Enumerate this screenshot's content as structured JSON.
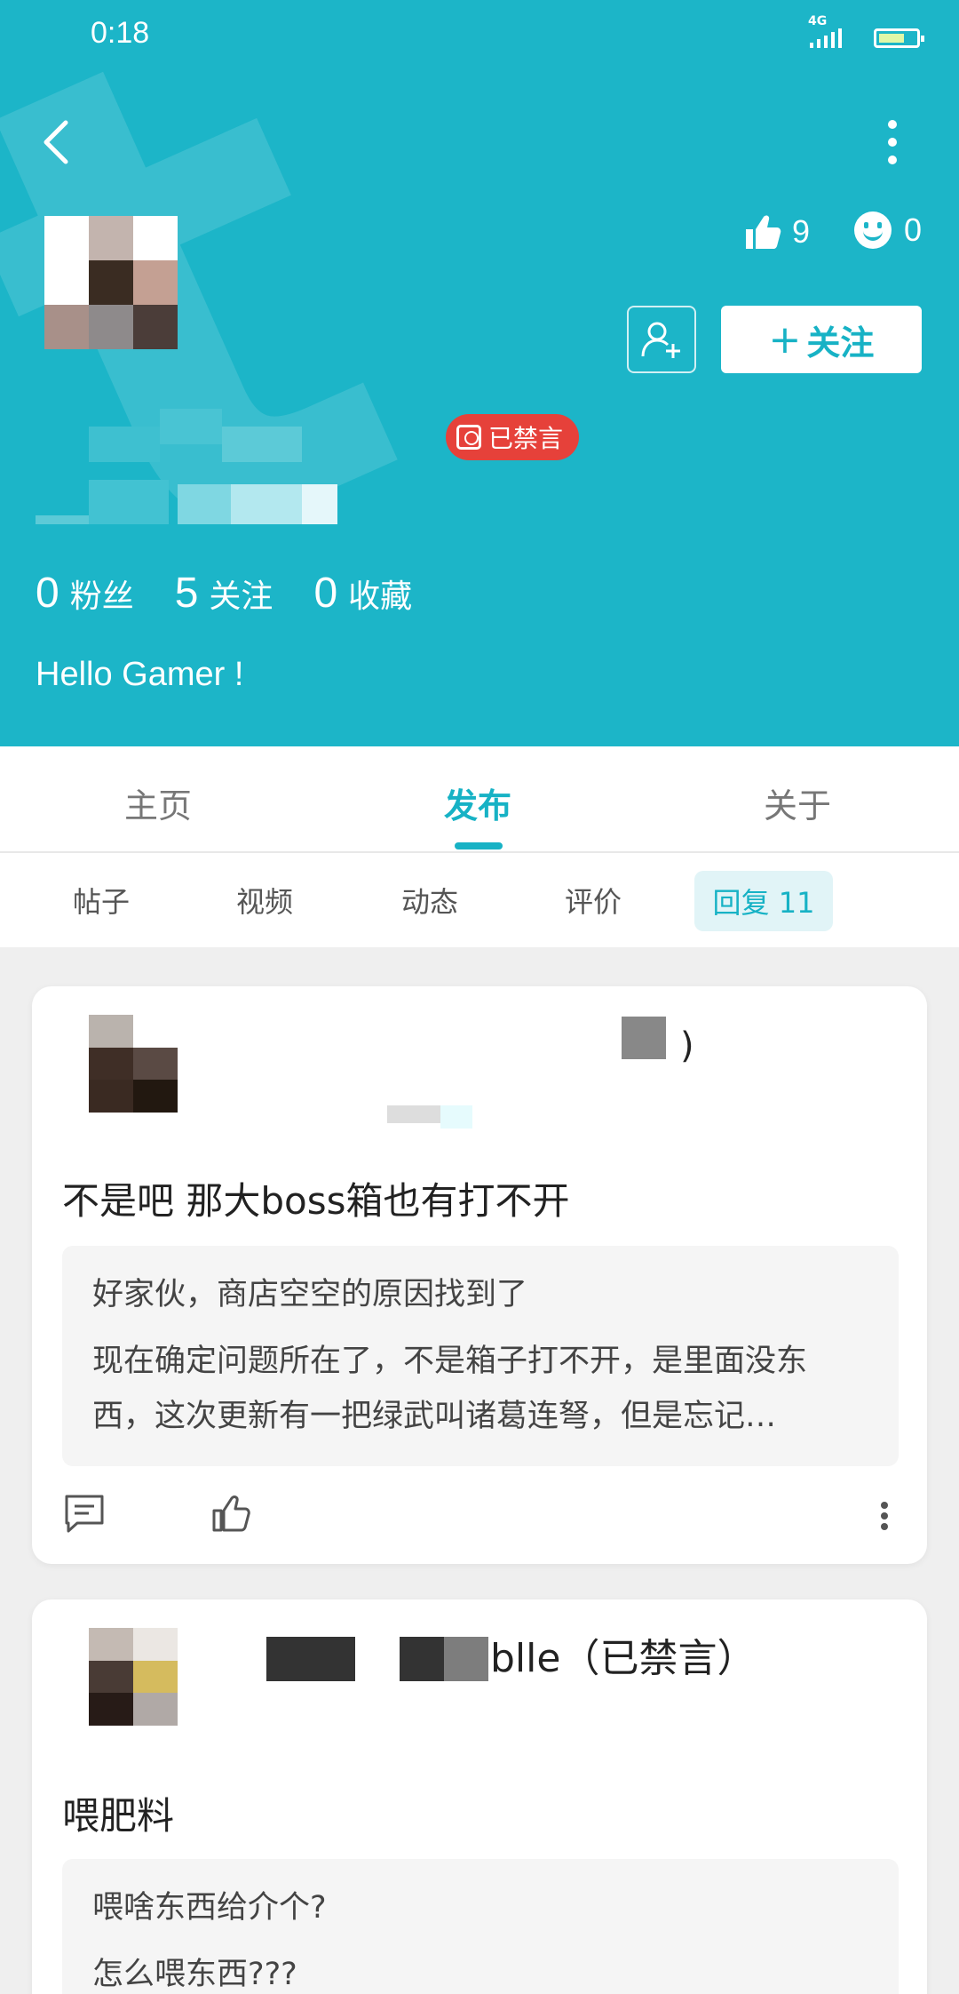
{
  "status_bar": {
    "time": "0:18",
    "network": "4G"
  },
  "profile": {
    "likes": "9",
    "emoji_count": "0",
    "follow_button": "关注",
    "follow_plus": "+",
    "ban_badge": "已禁言",
    "stats": [
      {
        "value": "0",
        "label": "粉丝"
      },
      {
        "value": "5",
        "label": "关注"
      },
      {
        "value": "0",
        "label": "收藏"
      }
    ],
    "bio": "Hello Gamer !"
  },
  "tabs": [
    "主页",
    "发布",
    "关于"
  ],
  "active_tab": "发布",
  "subtabs": [
    "帖子",
    "视频",
    "动态",
    "评价",
    "回复 11"
  ],
  "posts": [
    {
      "title": "不是吧 那大boss箱也有打不开",
      "quote_title": "好家伙，商店空空的原因找到了",
      "quote_body": "现在确定问题所在了，不是箱子打不开，是里面没东西，这次更新有一把绿武叫诸葛连弩，但是忘记…"
    },
    {
      "author_suffix": "blle",
      "author_status": "（已禁言）",
      "title": "喂肥料",
      "quote_title": "喂啥东西给介个?",
      "quote_body": "怎么喂东西???"
    }
  ],
  "colors": {
    "header_bg": "#1cb5c8",
    "accent": "#17b2c5",
    "ban_red": "#e6413a"
  }
}
